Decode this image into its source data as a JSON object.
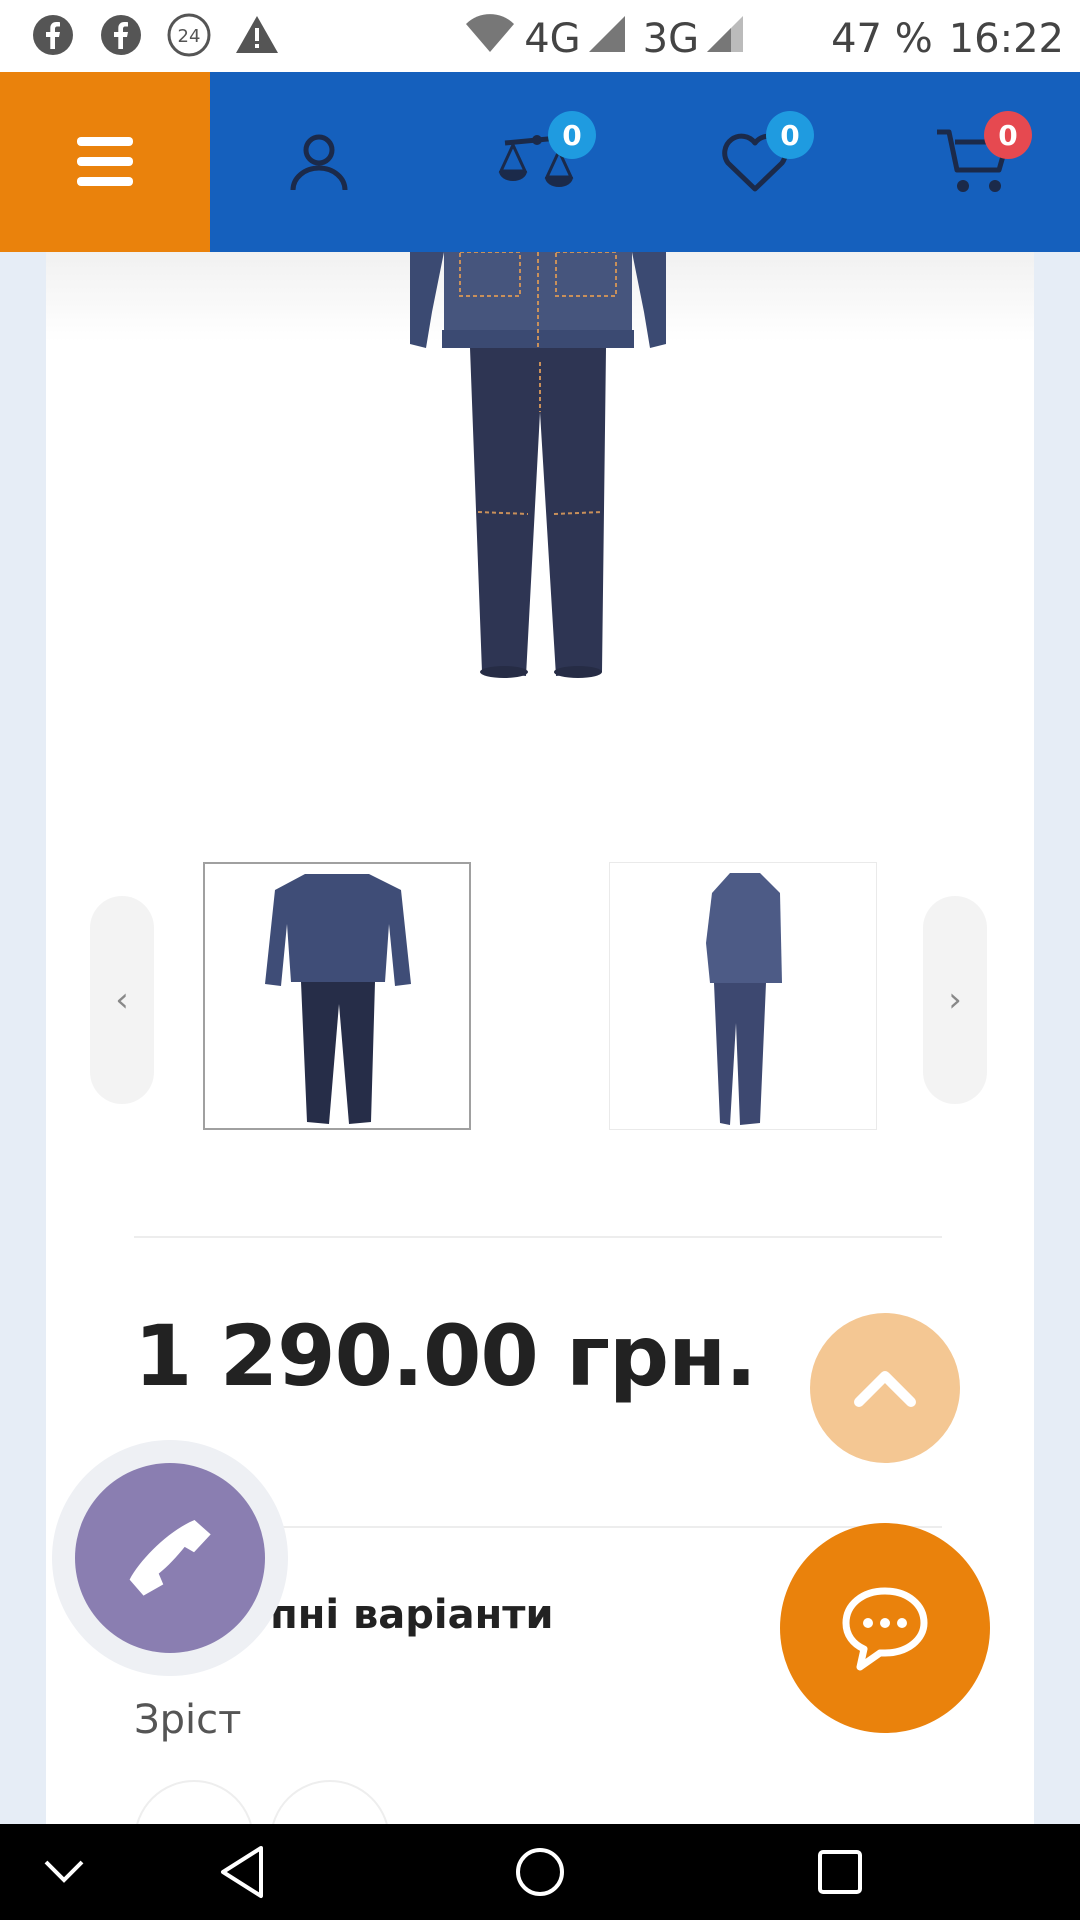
{
  "status_bar": {
    "notifications": [
      "facebook-icon",
      "facebook-icon",
      "24-icon",
      "warning-icon"
    ],
    "network_1": "4G",
    "network_2": "3G",
    "battery": "47 %",
    "time": "16:22"
  },
  "header": {
    "compare_count": "0",
    "wishlist_count": "0",
    "cart_count": "0",
    "colors": {
      "menu_bg": "#ea820c",
      "bar_bg": "#1560bd",
      "badge_blue": "#1f9be0",
      "badge_red": "#e64950"
    }
  },
  "gallery": {
    "prev_label": "‹",
    "next_label": "›"
  },
  "product": {
    "price": "1 290.00 грн.",
    "variants_title": "Доступні варіанти",
    "size_label": "Зріст"
  },
  "fabs": {
    "up_color": "#f4c793",
    "chat_color": "#ea820c",
    "phone_color": "#8a7eb1"
  }
}
